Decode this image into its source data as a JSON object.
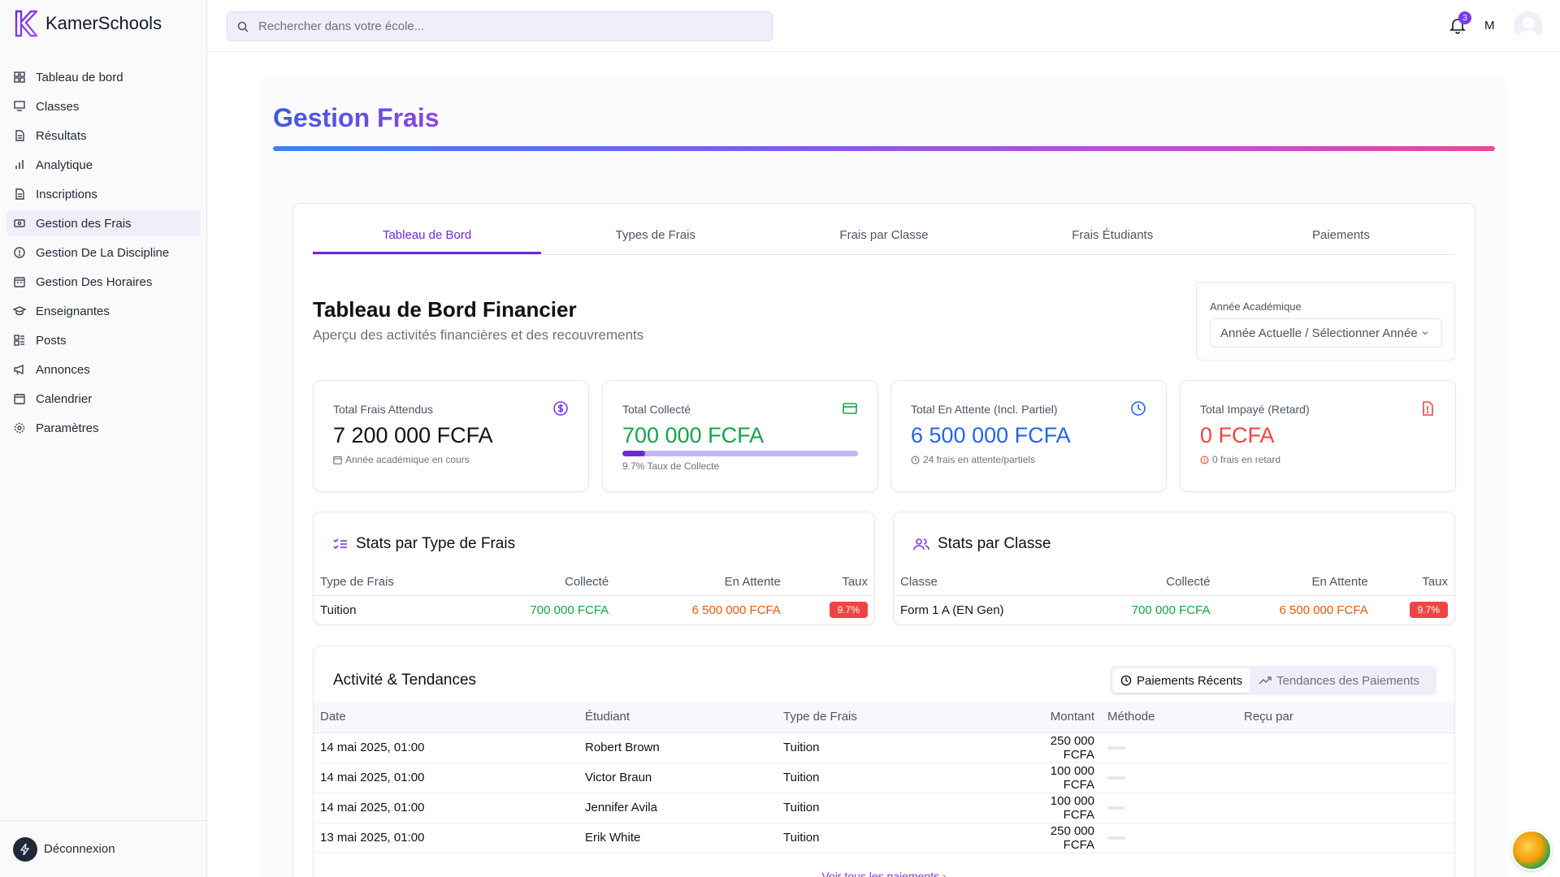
{
  "brand": {
    "name": "KamerSchools"
  },
  "sidebar": {
    "items": [
      {
        "label": "Tableau de bord",
        "icon": "dashboard-icon"
      },
      {
        "label": "Classes",
        "icon": "classes-icon"
      },
      {
        "label": "Résultats",
        "icon": "results-icon"
      },
      {
        "label": "Analytique",
        "icon": "analytics-icon"
      },
      {
        "label": "Inscriptions",
        "icon": "enrollment-icon"
      },
      {
        "label": "Gestion des Frais",
        "icon": "fees-icon",
        "active": true
      },
      {
        "label": "Gestion De La Discipline",
        "icon": "discipline-icon"
      },
      {
        "label": "Gestion Des Horaires",
        "icon": "schedule-icon"
      },
      {
        "label": "Enseignantes",
        "icon": "teachers-icon"
      },
      {
        "label": "Posts",
        "icon": "posts-icon"
      },
      {
        "label": "Annonces",
        "icon": "announcements-icon"
      },
      {
        "label": "Calendrier",
        "icon": "calendar-icon"
      },
      {
        "label": "Paramètres",
        "icon": "settings-icon"
      }
    ],
    "logout": "Déconnexion"
  },
  "topbar": {
    "search_placeholder": "Rechercher dans votre école...",
    "notifications_count": "3",
    "user_initial": "M"
  },
  "page": {
    "title": "Gestion Frais"
  },
  "tabs": [
    {
      "label": "Tableau de Bord",
      "active": true
    },
    {
      "label": "Types de Frais"
    },
    {
      "label": "Frais par Classe"
    },
    {
      "label": "Frais Étudiants"
    },
    {
      "label": "Paiements"
    }
  ],
  "dashboard": {
    "title": "Tableau de Bord Financier",
    "subtitle": "Aperçu des activités financières et des recouvrements",
    "year_label": "Année Académique",
    "year_value": "Année Actuelle / Sélectionner Année"
  },
  "cards": [
    {
      "label": "Total Frais Attendus",
      "value": "7 200 000 FCFA",
      "note": "Année académique en cours",
      "color": "#111111",
      "icon": "dollar-circle-icon"
    },
    {
      "label": "Total Collecté",
      "value": "700 000 FCFA",
      "note": "9.7% Taux de Collecte",
      "color": "#16a34a",
      "icon": "credit-card-icon",
      "progress": 0.097
    },
    {
      "label": "Total En Attente (Incl. Partiel)",
      "value": "6 500 000 FCFA",
      "note": "24 frais en attente/partiels",
      "color": "#2563eb",
      "icon": "clock-icon"
    },
    {
      "label": "Total Impayé (Retard)",
      "value": "0 FCFA",
      "note": "0 frais en retard",
      "color": "#ef4444",
      "icon": "alert-file-icon"
    }
  ],
  "stats_type": {
    "title": "Stats par Type de Frais",
    "headers": [
      "Type de Frais",
      "Collecté",
      "En Attente",
      "Taux"
    ],
    "rows": [
      {
        "name": "Tuition",
        "collected": "700 000 FCFA",
        "pending": "6 500 000 FCFA",
        "rate": "9.7%"
      }
    ]
  },
  "stats_class": {
    "title": "Stats par Classe",
    "headers": [
      "Classe",
      "Collecté",
      "En Attente",
      "Taux"
    ],
    "rows": [
      {
        "name": "Form 1 A (EN Gen)",
        "collected": "700 000 FCFA",
        "pending": "6 500 000 FCFA",
        "rate": "9.7%"
      }
    ]
  },
  "activity": {
    "title": "Activité & Tendances",
    "toggle_recent": "Paiements Récents",
    "toggle_trends": "Tendances des Paiements",
    "headers": [
      "Date",
      "Étudiant",
      "Type de Frais",
      "Montant",
      "Méthode",
      "Reçu par"
    ],
    "rows": [
      {
        "date": "14 mai 2025, 01:00",
        "student": "Robert Brown",
        "type": "Tuition",
        "amount": "250 000 FCFA"
      },
      {
        "date": "14 mai 2025, 01:00",
        "student": "Victor Braun",
        "type": "Tuition",
        "amount": "100 000 FCFA"
      },
      {
        "date": "14 mai 2025, 01:00",
        "student": "Jennifer Avila",
        "type": "Tuition",
        "amount": "100 000 FCFA"
      },
      {
        "date": "13 mai 2025, 01:00",
        "student": "Erik White",
        "type": "Tuition",
        "amount": "250 000 FCFA"
      }
    ],
    "see_all": "Voir tous les paiements ›"
  }
}
